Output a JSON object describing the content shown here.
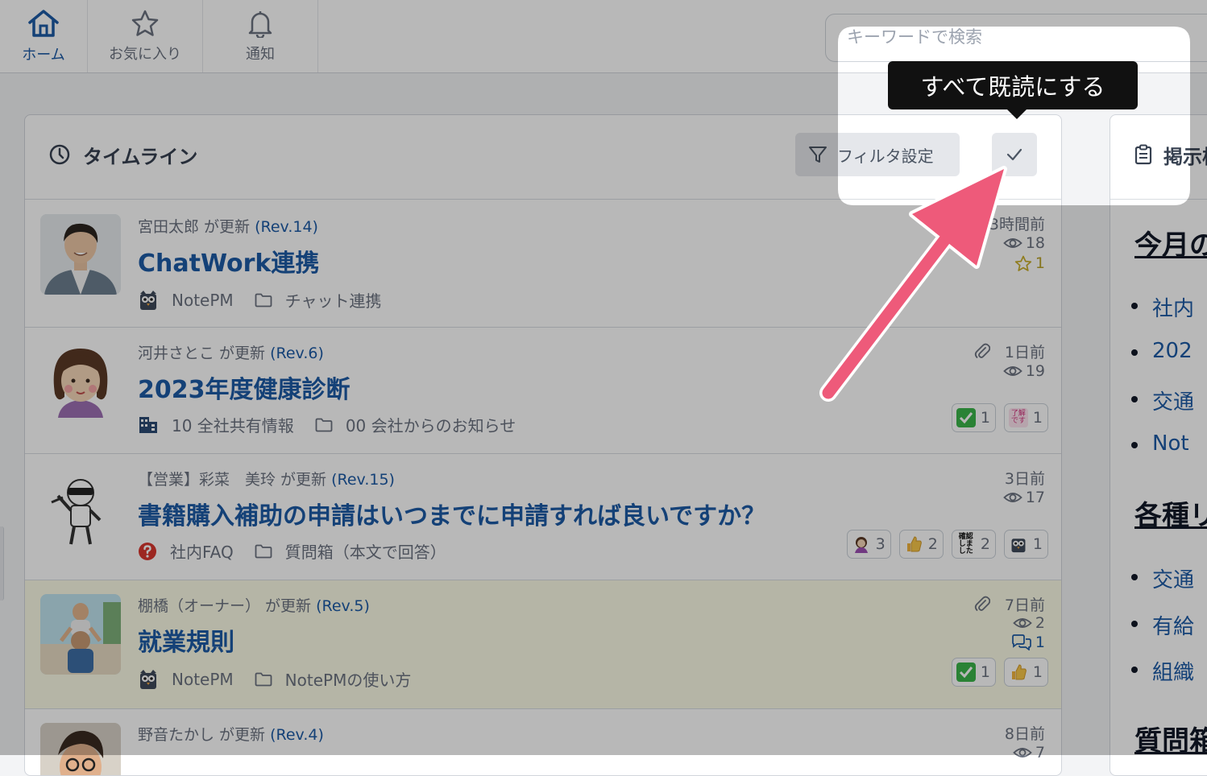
{
  "nav": {
    "tabs": [
      {
        "label": "ホーム",
        "icon": "home-icon",
        "active": true
      },
      {
        "label": "お気に入り",
        "icon": "star-icon",
        "active": false
      },
      {
        "label": "通知",
        "icon": "bell-icon",
        "active": false
      }
    ],
    "search_placeholder": "キーワードで検索"
  },
  "timeline": {
    "title": "タイムライン",
    "filter_label": "フィルタ設定",
    "tooltip": "すべて既読にする",
    "entries": [
      {
        "author": "宮田太郎",
        "action": " が更新 ",
        "rev": "(Rev.14)",
        "title": "ChatWork連携",
        "notebook": "NotePM",
        "folder": "チャット連携",
        "time": "3時間前",
        "views": "18",
        "stars": "1",
        "reactions": []
      },
      {
        "author": "河井さとこ",
        "action": " が更新 ",
        "rev": "(Rev.6)",
        "title": "2023年度健康診断",
        "notebook": "10 全社共有情報",
        "folder": "00 会社からのお知らせ",
        "time": "1日前",
        "views": "19",
        "reactions": [
          {
            "icon": "check-mark-emoji",
            "count": "1"
          },
          {
            "icon": "ryoukai-desu-stamp",
            "text": "了解です",
            "count": "1"
          }
        ]
      },
      {
        "author": "【営業】彩菜　美玲",
        "action": " が更新 ",
        "rev": "(Rev.15)",
        "title": "書籍購入補助の申請はいつまでに申請すれば良いですか？",
        "notebook": "社内FAQ",
        "folder": "質問箱（本文で回答）",
        "time": "3日前",
        "views": "17",
        "reactions": [
          {
            "icon": "woman-raising-hand-emoji",
            "count": "3"
          },
          {
            "icon": "thumbs-up-emoji",
            "count": "2"
          },
          {
            "icon": "kakunin-stamp",
            "text": "確認しました",
            "count": "2"
          },
          {
            "icon": "notepm-owl-stamp",
            "count": "1"
          }
        ]
      },
      {
        "author": "棚橋（オーナー）",
        "action": " が更新 ",
        "rev": "(Rev.5)",
        "title": "就業規則",
        "notebook": "NotePM",
        "folder": "NotePMの使い方",
        "time": "7日前",
        "views": "2",
        "comments": "1",
        "reactions": [
          {
            "icon": "check-mark-emoji",
            "count": "1"
          },
          {
            "icon": "thumbs-up-emoji",
            "count": "1"
          }
        ]
      },
      {
        "author": "野音たかし",
        "action": " が更新 ",
        "rev": "(Rev.4)",
        "title": "",
        "time": "8日前",
        "views": "7"
      }
    ]
  },
  "board": {
    "title": "掲示板",
    "sections": [
      {
        "heading": "今月の",
        "items": [
          "社内",
          "202",
          "交通",
          "Not"
        ]
      },
      {
        "heading": "各種リ",
        "items": [
          "交通",
          "有給",
          "組織"
        ]
      },
      {
        "heading": "質問箱",
        "items": []
      }
    ]
  },
  "colors": {
    "accent": "#1d5aa6",
    "arrow": "#ee5a7a",
    "tooltip_bg": "#111111"
  }
}
